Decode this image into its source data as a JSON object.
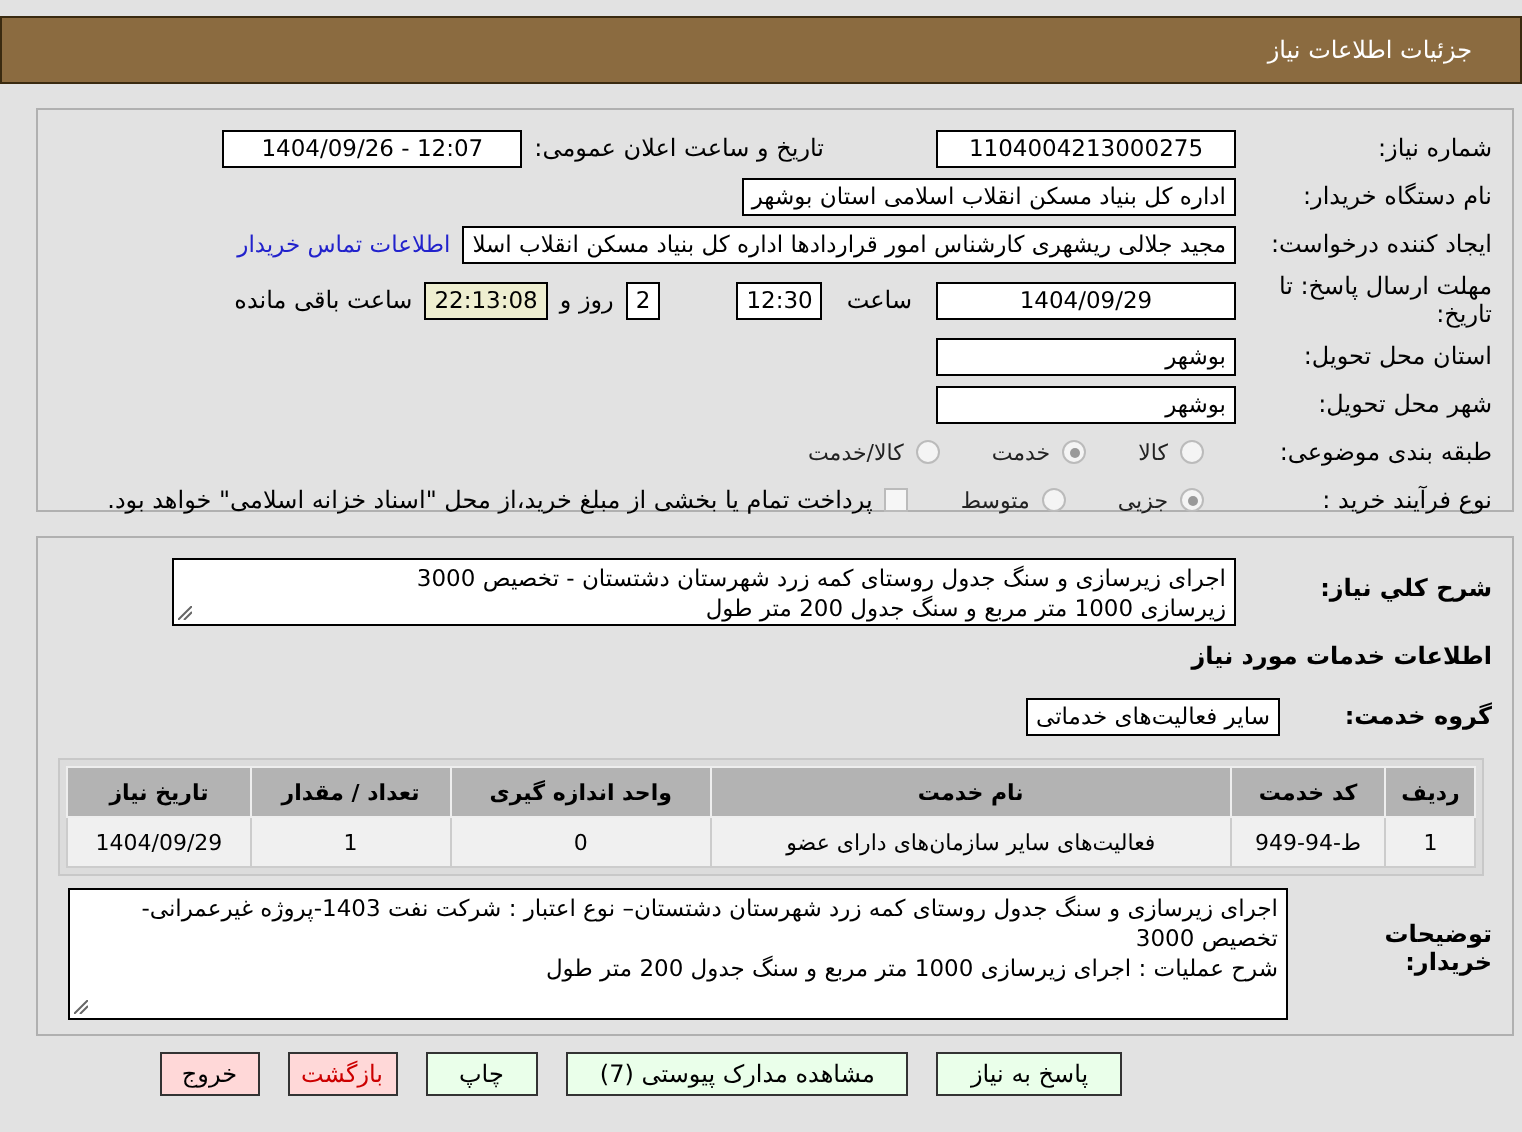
{
  "header": {
    "title": "جزئیات اطلاعات نیاز"
  },
  "need_number": {
    "label": "شماره نیاز:",
    "value": "1104004213000275"
  },
  "announce": {
    "label": "تاریخ و ساعت اعلان عمومی:",
    "value": "1404/09/26 - 12:07"
  },
  "buyer": {
    "label": "نام دستگاه خریدار:",
    "value": "اداره کل بنیاد مسکن انقلاب اسلامی استان بوشهر"
  },
  "creator": {
    "label": "ایجاد کننده درخواست:",
    "value": "مجید جلالی ریشهری کارشناس امور قراردادها اداره کل بنیاد مسکن انقلاب اسلا",
    "link": "اطلاعات تماس خریدار"
  },
  "deadline": {
    "label": "مهلت ارسال پاسخ: تا تاریخ:",
    "date": "1404/09/29",
    "time_label": "ساعت",
    "time": "12:30",
    "days": "2",
    "days_label": "روز و",
    "remaining": "22:13:08",
    "remaining_label": "ساعت باقی مانده"
  },
  "province": {
    "label": "استان محل تحویل:",
    "value": "بوشهر"
  },
  "city": {
    "label": "شهر محل تحویل:",
    "value": "بوشهر"
  },
  "category": {
    "label": "طبقه بندی موضوعی:",
    "options": [
      {
        "label": "کالا",
        "selected": false
      },
      {
        "label": "خدمت",
        "selected": true
      },
      {
        "label": "کالا/خدمت",
        "selected": false
      }
    ]
  },
  "purchase_type": {
    "label": "نوع فرآیند خرید :",
    "options": [
      {
        "label": "جزیی",
        "selected": true
      },
      {
        "label": "متوسط",
        "selected": false
      }
    ],
    "treasury": {
      "checked": false,
      "label": "پرداخت تمام یا بخشی از مبلغ خرید،از محل \"اسناد خزانه اسلامی\" خواهد بود."
    }
  },
  "description": {
    "label": "شرح کلي نیاز:",
    "value": "اجرای زیرسازی و سنگ جدول روستای کمه زرد شهرستان دشتستان - تخصیص 3000\nزیرسازی 1000 متر مربع و سنگ جدول 200 متر طول"
  },
  "services_heading": "اطلاعات خدمات مورد نیاز",
  "service_group": {
    "label": "گروه خدمت:",
    "value": "سایر فعالیت‌های خدماتی"
  },
  "table": {
    "columns": [
      "ردیف",
      "کد خدمت",
      "نام خدمت",
      "واحد اندازه گیری",
      "تعداد / مقدار",
      "تاریخ نیاز"
    ],
    "rows": [
      [
        "1",
        "ط-94-949",
        "فعالیت‌های سایر سازمان‌های دارای عضو",
        "0",
        "1",
        "1404/09/29"
      ]
    ]
  },
  "notes": {
    "label": "توضیحات خریدار:",
    "value": "اجرای زیرسازی و سنگ جدول روستای کمه زرد شهرستان دشتستان– نوع اعتبار : شرکت نفت 1403-پروژه غیرعمرانی-تخصیص 3000\nشرح عملیات : اجرای زیرسازی 1000 متر مربع و سنگ جدول 200 متر طول"
  },
  "buttons": [
    {
      "label": "پاسخ به نیاز",
      "kind": "action"
    },
    {
      "label": "مشاهده مدارک پیوستی (7)",
      "kind": "action"
    },
    {
      "label": "چاپ",
      "kind": "action"
    },
    {
      "label": "بازگشت",
      "kind": "back"
    },
    {
      "label": "خروج",
      "kind": "exit"
    }
  ]
}
